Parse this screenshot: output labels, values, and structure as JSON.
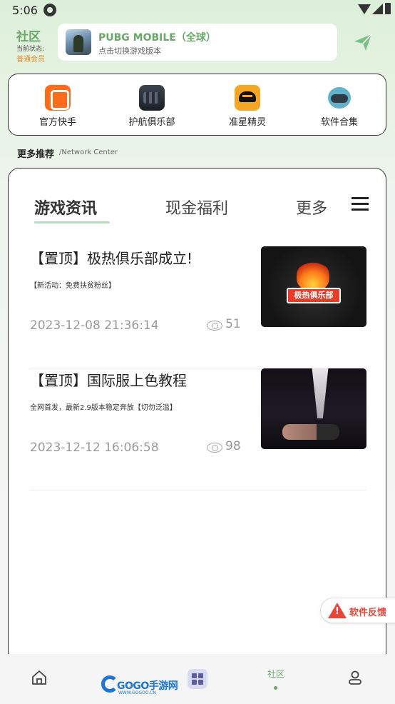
{
  "status_bar": {
    "time": "5:06"
  },
  "header": {
    "community_label": "社区",
    "state_label": "当前状态:",
    "member_level": "普通会员",
    "game": {
      "title": "PUBG MOBILE（全球）",
      "subtitle": "点击切换游戏版本"
    }
  },
  "quick_menu": [
    {
      "label": "官方快手",
      "icon": "kuaishou-icon"
    },
    {
      "label": "护航俱乐部",
      "icon": "club-icon"
    },
    {
      "label": "准星精灵",
      "icon": "crosshair-icon"
    },
    {
      "label": "软件合集",
      "icon": "gamepad-icon"
    }
  ],
  "section": {
    "title": "更多推荐",
    "subtitle": "/Network Center"
  },
  "tabs": {
    "news": "游戏资讯",
    "welfare": "现金福利",
    "more": "更多"
  },
  "news": [
    {
      "title": "【置顶】极热俱乐部成立!",
      "desc": "【新活动：免费扶贫粉丝】",
      "date": "2023-12-08 21:36:14",
      "views": "51",
      "thumb_text": "极热俱乐部"
    },
    {
      "title": "【置顶】国际服上色教程",
      "desc": "全网首发，最新2.9版本稳定奔放【切勿泛滥】",
      "date": "2023-12-12 16:06:58",
      "views": "98"
    }
  ],
  "feedback": {
    "label": "软件反馈"
  },
  "bottom_nav": {
    "community_label": "社区",
    "watermark_text": "GOGO手游网",
    "watermark_sub": "WWW.GOGOO.CN"
  },
  "colors": {
    "accent": "#6aa86a",
    "member": "#e08a2a",
    "warning": "#e8463a"
  }
}
